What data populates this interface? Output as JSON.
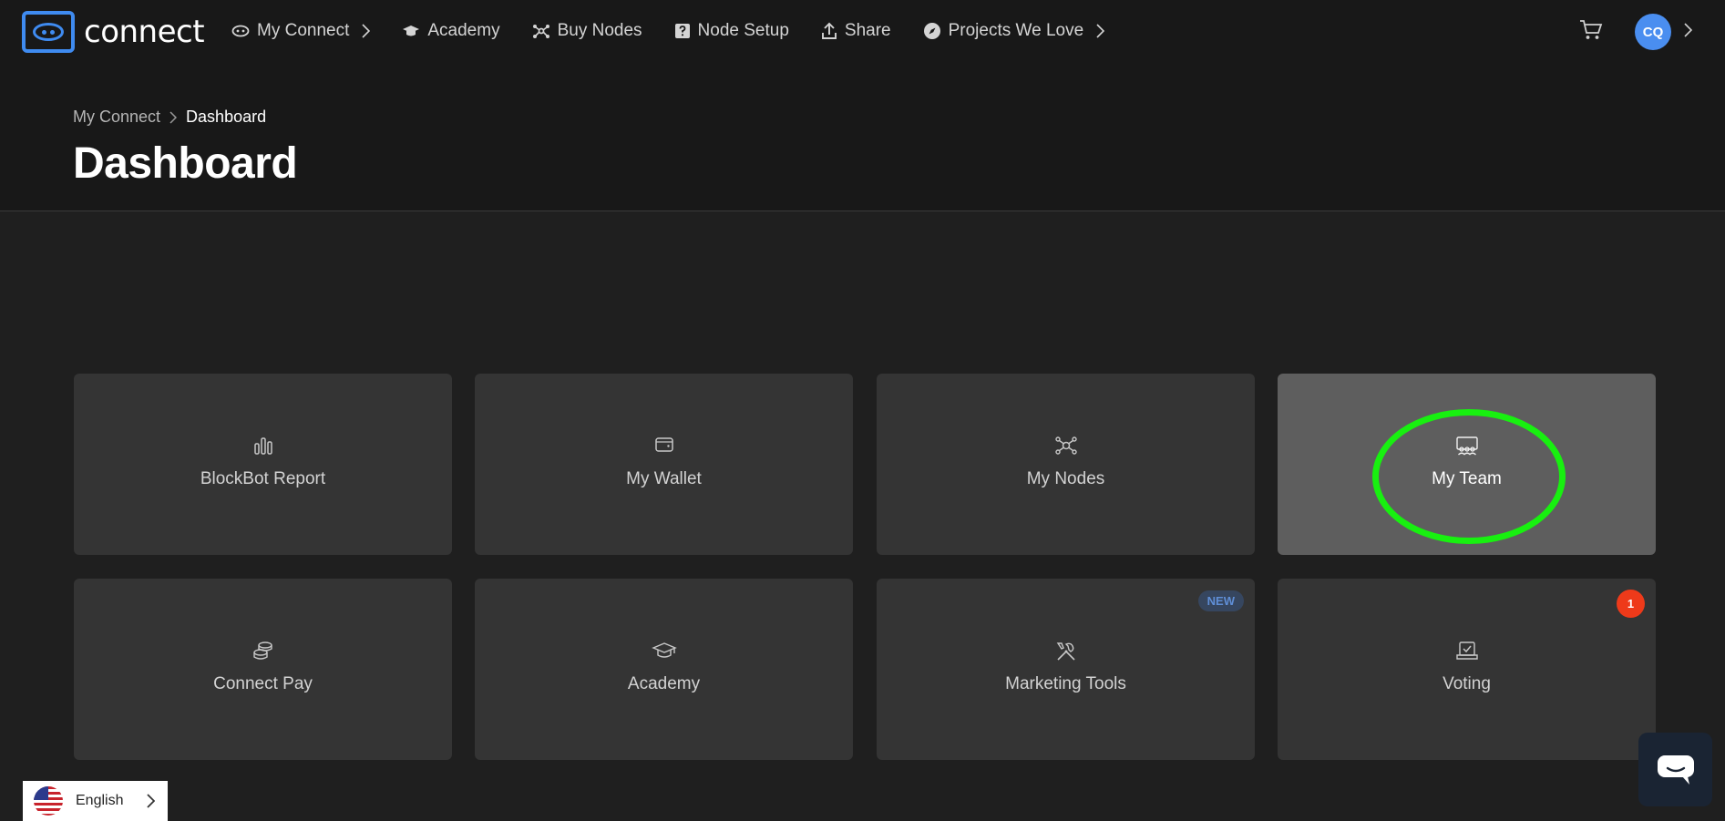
{
  "app": {
    "logo_text": "connect",
    "logo_icon": "connect-eye-logo",
    "accent": "#3f8bf0"
  },
  "nav": {
    "items": [
      {
        "label": "My Connect",
        "icon": "eye-icon",
        "has_chevron": true
      },
      {
        "label": "Academy",
        "icon": "graduation-cap-icon"
      },
      {
        "label": "Buy Nodes",
        "icon": "nodes-icon"
      },
      {
        "label": "Node Setup",
        "icon": "question-box-icon"
      },
      {
        "label": "Share",
        "icon": "upload-icon"
      },
      {
        "label": "Projects We Love",
        "icon": "compass-icon",
        "has_chevron": true
      }
    ],
    "cart_icon": "cart-icon",
    "avatar_initials": "CQ",
    "avatar_color": "#4a8ef0"
  },
  "breadcrumb": {
    "parent": "My Connect",
    "current": "Dashboard"
  },
  "page": {
    "title": "Dashboard"
  },
  "tiles": [
    {
      "label": "BlockBot Report",
      "icon": "bar-chart-icon"
    },
    {
      "label": "My Wallet",
      "icon": "wallet-icon"
    },
    {
      "label": "My Nodes",
      "icon": "nodes-icon"
    },
    {
      "label": "My Team",
      "icon": "team-icon",
      "state": "hovered"
    },
    {
      "label": "Connect Pay",
      "icon": "coins-icon"
    },
    {
      "label": "Academy",
      "icon": "graduation-cap-icon"
    },
    {
      "label": "Marketing Tools",
      "icon": "tools-icon",
      "badge": "NEW"
    },
    {
      "label": "Voting",
      "icon": "ballot-icon",
      "badge_count": "1"
    }
  ],
  "language": {
    "label": "English",
    "flag": "us-flag-icon"
  },
  "chat": {
    "icon": "chat-bubble-icon"
  },
  "colors": {
    "highlight": "#18f010",
    "badge_red": "#ee3a1a",
    "badge_new_text": "#5f8ed6"
  }
}
